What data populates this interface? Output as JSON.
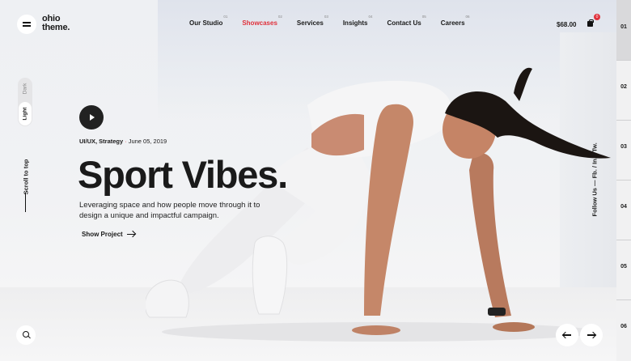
{
  "header": {
    "logo": [
      "ohio",
      "theme."
    ],
    "nav": [
      {
        "label": "Our Studio",
        "num": "01",
        "active": false
      },
      {
        "label": "Showcases",
        "num": "02",
        "active": true
      },
      {
        "label": "Services",
        "num": "03",
        "active": false
      },
      {
        "label": "Insights",
        "num": "04",
        "active": false
      },
      {
        "label": "Contact Us",
        "num": "05",
        "active": false
      },
      {
        "label": "Careers",
        "num": "06",
        "active": false
      }
    ],
    "cart_total": "$68.00",
    "cart_count": "0"
  },
  "theme_switch": {
    "dark": "Dark",
    "light": "Light"
  },
  "scroll_to_top": "Scroll to top",
  "hero": {
    "categories": "UI/UX, Strategy",
    "separator": "·",
    "date": "June 05, 2019",
    "title": "Sport Vibes.",
    "description": "Leveraging space and how people move through it to design a unique and impactful campaign.",
    "cta": "Show Project"
  },
  "follow": "Follow Us — Fb. / In. / Tw.",
  "slides": [
    "01",
    "02",
    "03",
    "04",
    "05",
    "06"
  ],
  "colors": {
    "accent": "#e0313c",
    "text": "#1a1a1a",
    "background": "#f0f0f2"
  }
}
